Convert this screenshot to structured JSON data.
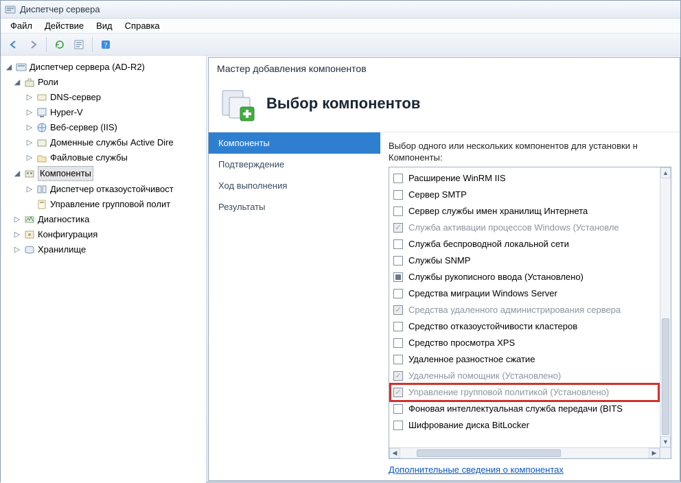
{
  "window": {
    "title": "Диспетчер сервера"
  },
  "menu": {
    "file": "Файл",
    "action": "Действие",
    "view": "Вид",
    "help": "Справка"
  },
  "tree": {
    "root": "Диспетчер сервера (AD-R2)",
    "roles": "Роли",
    "roles_items": {
      "dns": "DNS-сервер",
      "hyperv": "Hyper-V",
      "iis": "Веб-сервер (IIS)",
      "adds": "Доменные службы Active Dire",
      "file": "Файловые службы"
    },
    "features": "Компоненты",
    "features_items": {
      "failover": "Диспетчер отказоустойчивост",
      "gpmc": "Управление групповой полит"
    },
    "diag": "Диагностика",
    "config": "Конфигурация",
    "storage": "Хранилище"
  },
  "wizard": {
    "title": "Мастер добавления компонентов",
    "header": "Выбор компонентов",
    "steps": {
      "s1": "Компоненты",
      "s2": "Подтверждение",
      "s3": "Ход выполнения",
      "s4": "Результаты"
    },
    "instr": "Выбор одного или нескольких компонентов для установки н",
    "listlabel": "Компоненты:",
    "items": {
      "i0": "Расширение WinRM IIS",
      "i1": "Сервер SMTP",
      "i2": "Сервер службы имен хранилищ Интернета",
      "i3": "Служба активации процессов Windows (Установле",
      "i4": "Служба беспроводной локальной сети",
      "i5": "Службы SNMP",
      "i6": "Службы рукописного ввода (Установлено)",
      "i7": "Средства миграции Windows Server",
      "i8": "Средства удаленного администрирования сервера",
      "i9": "Средство отказоустойчивости кластеров",
      "i10": "Средство просмотра XPS",
      "i11": "Удаленное разностное сжатие",
      "i12": "Удаленный помощник (Установлено)",
      "i13": "Управление групповой политикой (Установлено)",
      "i14": "Фоновая интеллектуальная служба передачи (BITS",
      "i15": "Шифрование диска BitLocker"
    },
    "morelink": "Дополнительные сведения о компонентах"
  }
}
